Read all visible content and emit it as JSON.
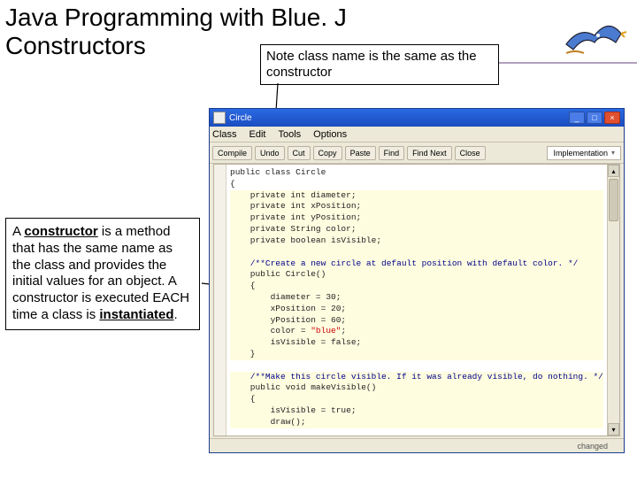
{
  "slide": {
    "title": "Java Programming with Blue. J",
    "subtitle": "Constructors"
  },
  "callouts": {
    "top": "Note class name is the same as the constructor",
    "left_html": "A <b><u>constructor</u></b> is a method that has the same name as the class and provides the initial values for an object.  A constructor is executed EACH time a class is <b><u>instantiated</u></b>."
  },
  "window": {
    "title": "Circle",
    "minimize": "_",
    "maximize": "□",
    "close": "×"
  },
  "menu": [
    "Class",
    "Edit",
    "Tools",
    "Options"
  ],
  "toolbar": [
    "Compile",
    "Undo",
    "Cut",
    "Copy",
    "Paste",
    "Find",
    "Find Next",
    "Close"
  ],
  "mode": "Implementation",
  "status": "changed",
  "code": {
    "l0": "public class Circle",
    "l1": "{",
    "l2": "    private int diameter;",
    "l3": "    private int xPosition;",
    "l4": "    private int yPosition;",
    "l5": "    private String color;",
    "l6": "    private boolean isVisible;",
    "c1": "    /**Create a new circle at default position with default color. */",
    "l7": "    public Circle()",
    "l8": "    {",
    "l9": "        diameter = 30;",
    "l10": "        xPosition = 20;",
    "l11": "        yPosition = 60;",
    "l12a": "        color = ",
    "l12s": "\"blue\"",
    "l12b": ";",
    "l13": "        isVisible = false;",
    "l14": "    }",
    "c2": "    /**Make this circle visible. If it was already visible, do nothing. */",
    "l15": "    public void makeVisible()",
    "l16": "    {",
    "l17": "        isVisible = true;",
    "l18": "        draw();"
  }
}
